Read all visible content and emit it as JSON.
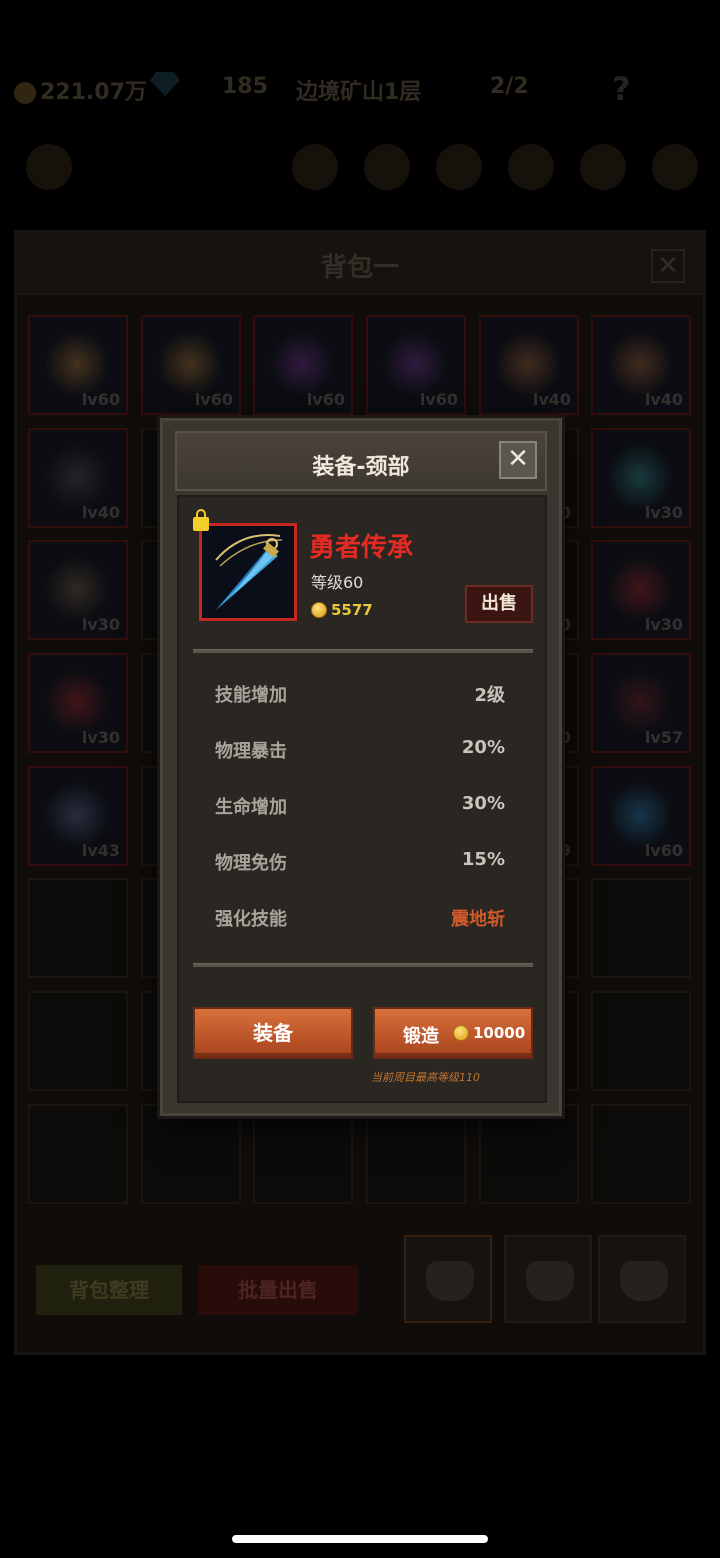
{
  "hud": {
    "gold": "221.07万",
    "gems": "185",
    "stage": "边境矿山1层",
    "energy": "2/2",
    "help": "?"
  },
  "backpack": {
    "title": "背包一",
    "close": "✕",
    "slots": [
      {
        "lv": "lv60",
        "kind": "bow"
      },
      {
        "lv": "lv60",
        "kind": "bow"
      },
      {
        "lv": "lv60",
        "kind": "orb"
      },
      {
        "lv": "lv60",
        "kind": "orb"
      },
      {
        "lv": "lv40",
        "kind": "trident"
      },
      {
        "lv": "lv40",
        "kind": "trident"
      },
      {
        "lv": "lv40",
        "kind": "crossbow"
      },
      {
        "lv": "",
        "kind": "hidden"
      },
      {
        "lv": "",
        "kind": "hidden"
      },
      {
        "lv": "",
        "kind": "hidden"
      },
      {
        "lv": "0",
        "kind": "hidden"
      },
      {
        "lv": "lv30",
        "kind": "net"
      },
      {
        "lv": "lv30",
        "kind": "boots"
      },
      {
        "lv": "",
        "kind": "hidden"
      },
      {
        "lv": "",
        "kind": "hidden"
      },
      {
        "lv": "",
        "kind": "hidden"
      },
      {
        "lv": "0",
        "kind": "hidden"
      },
      {
        "lv": "lv30",
        "kind": "amulet"
      },
      {
        "lv": "lv30",
        "kind": "amulet"
      },
      {
        "lv": "",
        "kind": "hidden"
      },
      {
        "lv": "",
        "kind": "hidden"
      },
      {
        "lv": "",
        "kind": "hidden"
      },
      {
        "lv": "0",
        "kind": "hidden"
      },
      {
        "lv": "lv57",
        "kind": "helmet"
      },
      {
        "lv": "lv43",
        "kind": "pendant"
      },
      {
        "lv": "",
        "kind": "hidden"
      },
      {
        "lv": "",
        "kind": "hidden"
      },
      {
        "lv": "",
        "kind": "hidden"
      },
      {
        "lv": "9",
        "kind": "hidden"
      },
      {
        "lv": "lv60",
        "kind": "pendulum"
      },
      {
        "lv": "",
        "kind": "empty"
      },
      {
        "lv": "",
        "kind": "empty"
      },
      {
        "lv": "",
        "kind": "empty"
      },
      {
        "lv": "",
        "kind": "empty"
      },
      {
        "lv": "",
        "kind": "empty"
      },
      {
        "lv": "",
        "kind": "empty"
      },
      {
        "lv": "",
        "kind": "empty"
      },
      {
        "lv": "",
        "kind": "empty"
      },
      {
        "lv": "",
        "kind": "empty"
      },
      {
        "lv": "",
        "kind": "empty"
      },
      {
        "lv": "",
        "kind": "empty"
      },
      {
        "lv": "",
        "kind": "empty"
      },
      {
        "lv": "",
        "kind": "empty"
      },
      {
        "lv": "",
        "kind": "empty"
      },
      {
        "lv": "",
        "kind": "empty"
      },
      {
        "lv": "",
        "kind": "empty"
      },
      {
        "lv": "",
        "kind": "empty"
      },
      {
        "lv": "",
        "kind": "empty"
      }
    ],
    "sort_label": "背包整理",
    "bulk_sell_label": "批量出售"
  },
  "dialog": {
    "title": "装备-颈部",
    "close": "✕",
    "item": {
      "name": "勇者传承",
      "level": "等级60",
      "price": "5577",
      "name_color": "#e42a22"
    },
    "sell_label": "出售",
    "stats": [
      {
        "name": "技能增加",
        "value": "2级"
      },
      {
        "name": "物理暴击",
        "value": "20%"
      },
      {
        "name": "生命增加",
        "value": "30%"
      },
      {
        "name": "物理免伤",
        "value": "15%"
      },
      {
        "name": "强化技能",
        "value": "震地斩"
      }
    ],
    "equip_label": "装备",
    "forge_label": "锻造",
    "forge_cost": "10000",
    "max_level_note": "当前周目最高等级110"
  }
}
